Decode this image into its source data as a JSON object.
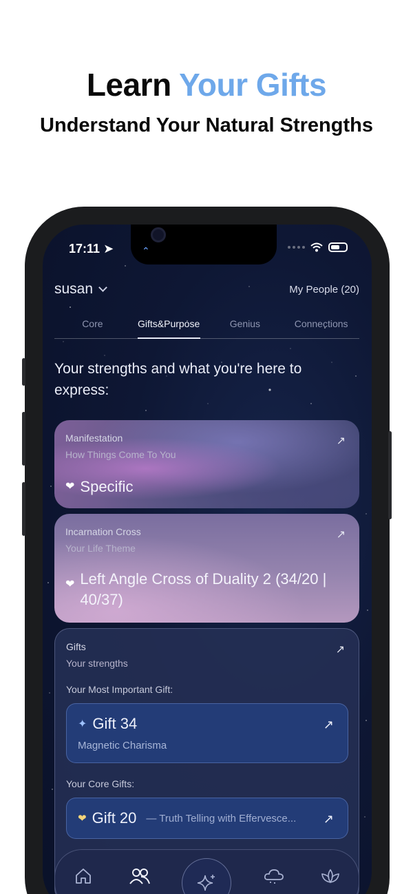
{
  "headline": {
    "part1": "Learn ",
    "part2": "Your Gifts"
  },
  "subheadline": "Understand Your Natural Strengths",
  "status": {
    "time": "17:11"
  },
  "header": {
    "username": "susan",
    "my_people": "My People (20)"
  },
  "tabs": [
    {
      "label": "Core",
      "active": false
    },
    {
      "label": "Gifts&Purpose",
      "active": true
    },
    {
      "label": "Genius",
      "active": false
    },
    {
      "label": "Connections",
      "active": false
    }
  ],
  "intro": "Your strengths and what you're here to express:",
  "manifestation": {
    "label": "Manifestation",
    "sub": "How Things Come To You",
    "value": "Specific"
  },
  "incarnation": {
    "label": "Incarnation Cross",
    "sub": "Your Life Theme",
    "value": "Left Angle Cross of Duality 2 (34/20 | 40/37)"
  },
  "gifts": {
    "label": "Gifts",
    "sub": "Your strengths",
    "important_label": "Your Most Important Gift:",
    "important": {
      "title": "Gift 34",
      "sub": "Magnetic Charisma"
    },
    "core_label": "Your Core Gifts:",
    "core": [
      {
        "title": "Gift 20",
        "desc": "— Truth Telling with Effervesce..."
      }
    ]
  },
  "nav": [
    "home-icon",
    "people-icon",
    "sparkle-icon",
    "cloud-icon",
    "lotus-icon"
  ],
  "colors": {
    "accent": "#6ea8ea",
    "screen_bg": "#0e1734",
    "gift_box": "#233c77"
  }
}
